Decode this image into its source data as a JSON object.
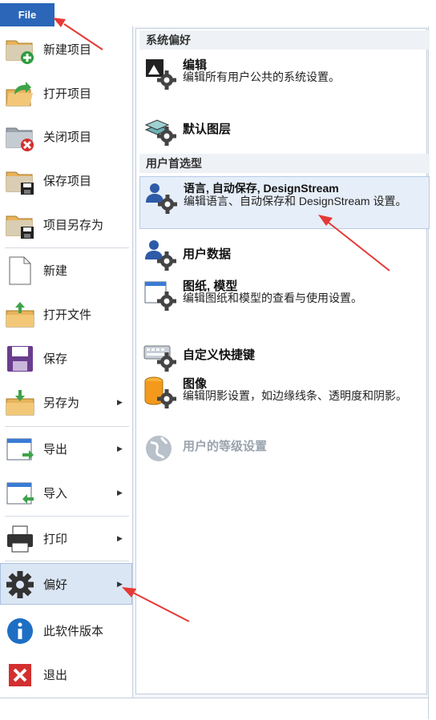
{
  "file_tab": {
    "label": "File"
  },
  "menu": {
    "items": [
      {
        "label": "新建项目",
        "icon": "folder-new-icon"
      },
      {
        "label": "打开项目",
        "icon": "folder-open-icon"
      },
      {
        "label": "关闭项目",
        "icon": "folder-close-icon"
      },
      {
        "label": "保存项目",
        "icon": "folder-save-icon"
      },
      {
        "label": "项目另存为",
        "icon": "folder-save-as-icon"
      },
      {
        "label": "新建",
        "icon": "blank-page-icon"
      },
      {
        "label": "打开文件",
        "icon": "open-file-icon"
      },
      {
        "label": "保存",
        "icon": "floppy-icon"
      },
      {
        "label": "另存为",
        "icon": "save-as-icon",
        "submenu": true
      },
      {
        "label": "导出",
        "icon": "export-icon",
        "submenu": true
      },
      {
        "label": "导入",
        "icon": "import-icon",
        "submenu": true
      },
      {
        "label": "打印",
        "icon": "printer-icon",
        "submenu": true
      },
      {
        "label": "偏好",
        "icon": "gear-icon",
        "submenu": true,
        "selected": true
      },
      {
        "label": "此软件版本",
        "icon": "info-icon"
      },
      {
        "label": "退出",
        "icon": "exit-icon"
      }
    ]
  },
  "panel": {
    "sections": [
      {
        "title": "系统偏好"
      },
      {
        "title": "用户首选型"
      }
    ],
    "items": [
      {
        "title": "编辑",
        "desc": "编辑所有用户公共的系统设置。",
        "icon": "edit-settings-icon"
      },
      {
        "title": "默认图层",
        "desc": "",
        "icon": "layers-gear-icon"
      },
      {
        "title": "语言, 自动保存, DesignStream",
        "desc": "编辑语言、自动保存和 DesignStream 设置。",
        "icon": "user-gear-icon",
        "selected": true
      },
      {
        "title": "用户数据",
        "desc": "",
        "icon": "user-data-icon"
      },
      {
        "title": "图纸, 模型",
        "desc": "编辑图纸和模型的查看与使用设置。",
        "icon": "drawing-model-icon"
      },
      {
        "title": "自定义快捷键",
        "desc": "",
        "icon": "keyboard-gear-icon"
      },
      {
        "title": "图像",
        "desc": "编辑阴影设置，如边缘线条、透明度和阴影。",
        "icon": "image-gear-icon"
      },
      {
        "title": "用户的等级设置",
        "desc": "",
        "icon": "globe-icon",
        "disabled": true
      }
    ]
  },
  "colors": {
    "accent": "#2b66b9",
    "arrow": "#e53935"
  }
}
